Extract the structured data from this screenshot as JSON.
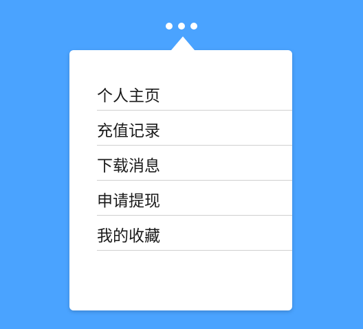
{
  "header": {
    "more_icon": "more-dots-icon"
  },
  "menu": {
    "items": [
      {
        "label": "个人主页"
      },
      {
        "label": "充值记录"
      },
      {
        "label": "下载消息"
      },
      {
        "label": "申请提现"
      },
      {
        "label": "我的收藏"
      }
    ]
  },
  "colors": {
    "background": "#4aa3ff",
    "popover": "#ffffff",
    "divider": "#cfcfcf",
    "text": "#1a1a1a"
  }
}
